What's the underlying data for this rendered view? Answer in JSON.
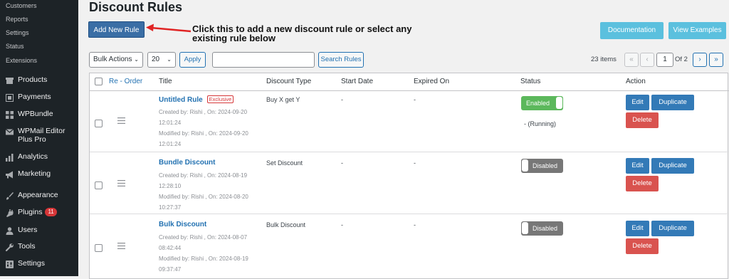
{
  "sidebar": {
    "sub_items": [
      "Customers",
      "Reports",
      "Settings",
      "Status",
      "Extensions"
    ],
    "items": [
      {
        "label": "Products",
        "icon": "products-icon"
      },
      {
        "label": "Payments",
        "icon": "payments-icon"
      },
      {
        "label": "WPBundle",
        "icon": "grid-icon"
      },
      {
        "label": "WPMail Editor Plus Pro",
        "icon": "mail-icon"
      },
      {
        "label": "Analytics",
        "icon": "bar-chart-icon"
      },
      {
        "label": "Marketing",
        "icon": "megaphone-icon"
      },
      {
        "label": "Appearance",
        "icon": "brush-icon"
      },
      {
        "label": "Plugins",
        "icon": "plug-icon",
        "badge": "11"
      },
      {
        "label": "Users",
        "icon": "user-icon"
      },
      {
        "label": "Tools",
        "icon": "wrench-icon"
      },
      {
        "label": "Settings",
        "icon": "settings-icon"
      }
    ]
  },
  "page": {
    "title": "Discount Rules",
    "add_new_label": "Add New Rule",
    "callout": "Click this to add a new discount rule or select any existing rule below",
    "documentation_label": "Documentation",
    "view_examples_label": "View Examples"
  },
  "toolbar": {
    "bulk_actions": "Bulk Actions",
    "per_page": "20",
    "apply_label": "Apply",
    "search_placeholder": "",
    "search_button": "Search Rules",
    "items_count": "23 items",
    "first": "«",
    "prev": "‹",
    "current_page": "1",
    "of_pages": "Of 2",
    "next": "›",
    "last": "»"
  },
  "table": {
    "headers": {
      "reorder": "Re - Order",
      "title": "Title",
      "discount_type": "Discount Type",
      "start_date": "Start Date",
      "expired_on": "Expired On",
      "status": "Status",
      "action": "Action"
    },
    "actions": {
      "edit": "Edit",
      "duplicate": "Duplicate",
      "delete": "Delete"
    },
    "rows": [
      {
        "title": "Untitled Rule",
        "badge": "Exclusive",
        "created": "Created by: Rishi , On: 2024-09-20 12:01:24",
        "modified": "Modified by: Rishi , On: 2024-09-20 12:01:24",
        "discount_type": "Buy X get Y",
        "start_date": "-",
        "expired_on": "-",
        "status": "Enabled",
        "status_on": true,
        "running": "- (Running)"
      },
      {
        "title": "Bundle Discount",
        "created": "Created by: Rishi , On: 2024-08-19 12:28:10",
        "modified": "Modified by: Rishi , On: 2024-08-20 10:27:37",
        "discount_type": "Set Discount",
        "start_date": "-",
        "expired_on": "-",
        "status": "Disabled",
        "status_on": false
      },
      {
        "title": "Bulk Discount",
        "created": "Created by: Rishi , On: 2024-08-07 08:42:44",
        "modified": "Modified by: Rishi , On: 2024-08-19 09:37:47",
        "discount_type": "Bulk Discount",
        "start_date": "-",
        "expired_on": "-",
        "status": "Disabled",
        "status_on": false
      }
    ]
  },
  "colors": {
    "sidebar_bg": "#1d2327",
    "primary": "#3a6ea5",
    "info": "#5bc0de",
    "enabled": "#5cb85c",
    "disabled": "#777777",
    "delete": "#d9534f",
    "arrow": "#e02424"
  }
}
